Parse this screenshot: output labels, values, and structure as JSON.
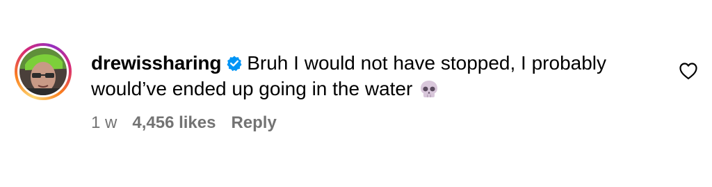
{
  "comment": {
    "username": "drewissharing",
    "line1": "Bruh I would not have stopped, I probably",
    "line2": "would’ve ended up going in the water",
    "time_ago": "1 w",
    "likes": "4,456 likes",
    "reply_label": "Reply"
  },
  "icons": {
    "verified": "verified-badge-icon",
    "skull": "skull-emoji-icon",
    "like": "heart-icon"
  },
  "colors": {
    "verified_blue": "#0095f6",
    "meta_gray": "#737373",
    "text": "#000000"
  }
}
